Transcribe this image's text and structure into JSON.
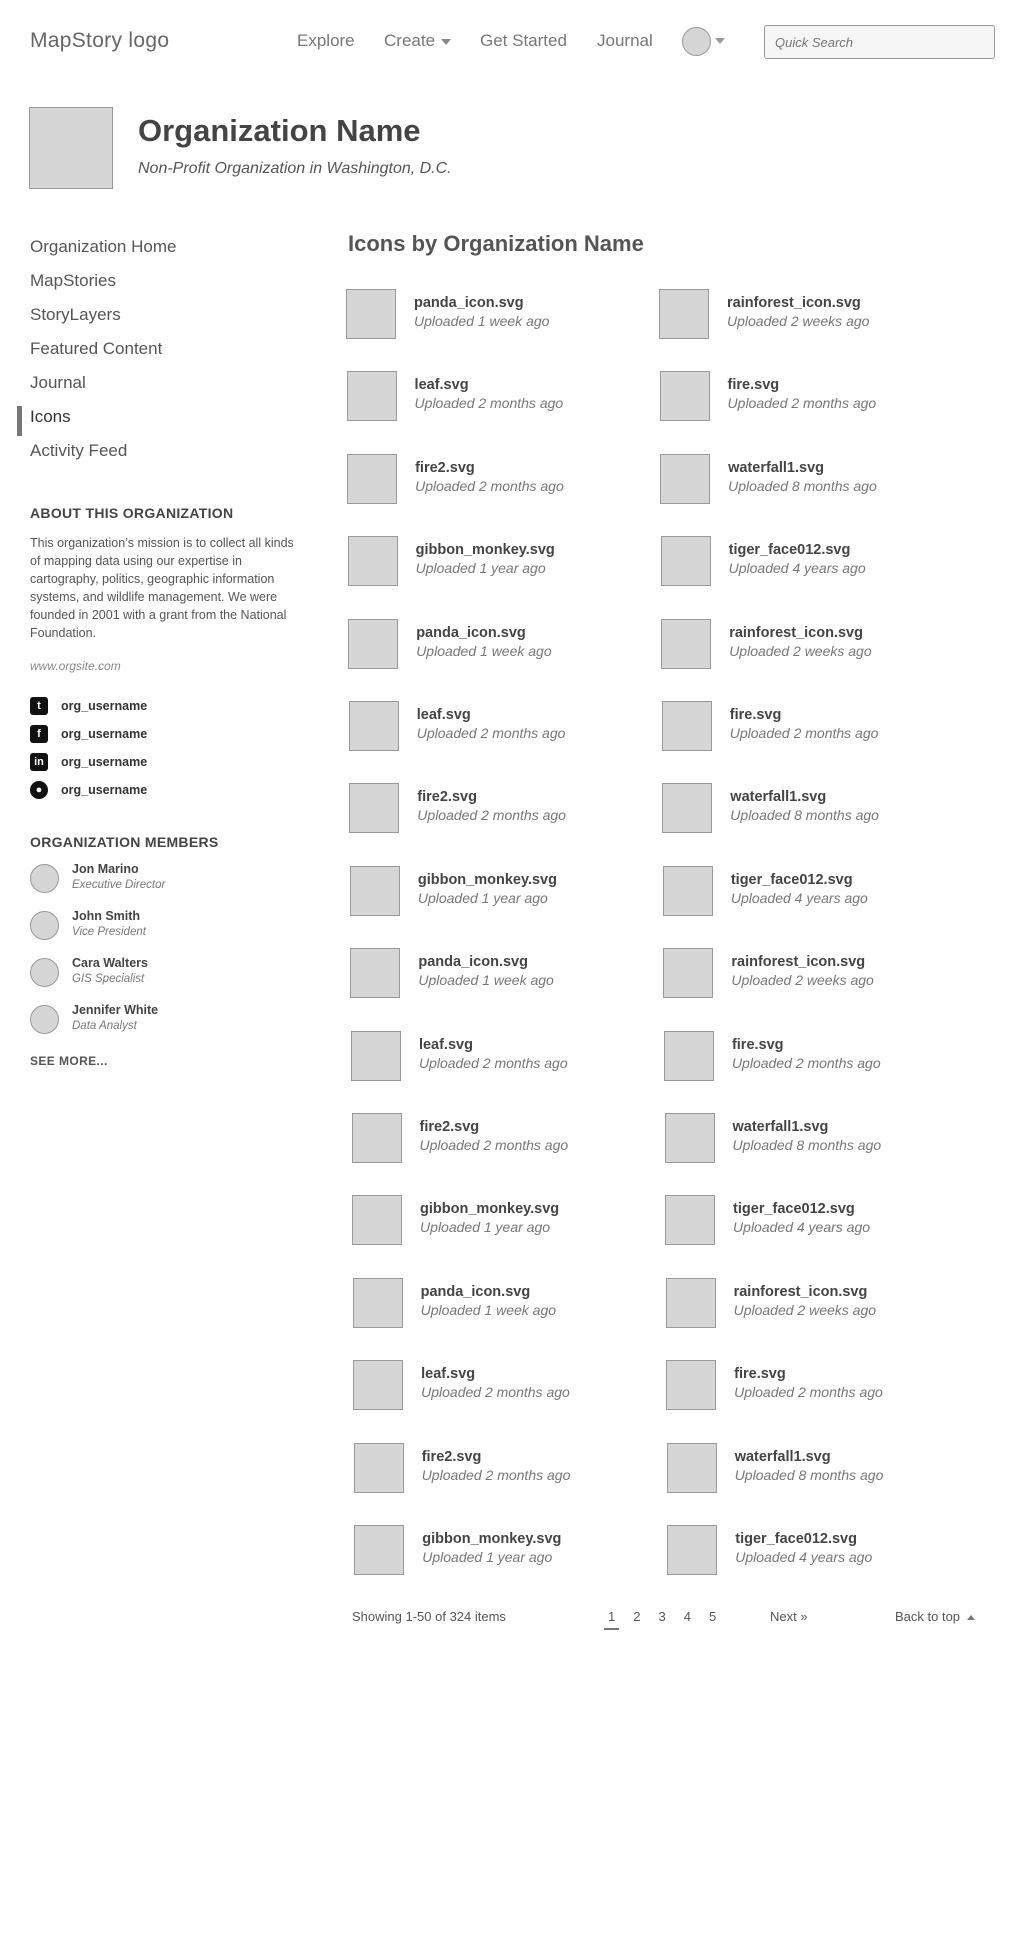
{
  "header": {
    "logo": "MapStory logo",
    "nav": [
      "Explore",
      "Create",
      "Get Started",
      "Journal"
    ],
    "search_placeholder": "Quick Search"
  },
  "org": {
    "name": "Organization Name",
    "subtitle": "Non-Profit Organization in Washington, D.C."
  },
  "sidebar": {
    "items": [
      "Organization Home",
      "MapStories",
      "StoryLayers",
      "Featured Content",
      "Journal",
      "Icons",
      "Activity Feed"
    ],
    "active_index": 5,
    "about_title": "ABOUT THIS ORGANIZATION",
    "about_text": "This organization’s mission is to collect all kinds of mapping data using our expertise in cartography, politics, geographic information systems, and wildlife management. We were founded in 2001 with a grant from the National Foundation.",
    "website": "www.orgsite.com",
    "social": [
      {
        "icon": "twitter-icon",
        "label": "org_username"
      },
      {
        "icon": "facebook-icon",
        "label": "org_username"
      },
      {
        "icon": "linkedin-icon",
        "label": "org_username"
      },
      {
        "icon": "github-icon",
        "label": "org_username"
      }
    ],
    "members_title": "ORGANIZATION MEMBERS",
    "members": [
      {
        "name": "Jon Marino",
        "role": "Executive Director"
      },
      {
        "name": "John Smith",
        "role": "Vice President"
      },
      {
        "name": "Cara Walters",
        "role": "GIS Specialist"
      },
      {
        "name": "Jennifer White",
        "role": "Data Analyst"
      }
    ],
    "see_more": "SEE MORE..."
  },
  "main": {
    "title": "Icons by Organization Name",
    "icons": [
      {
        "name": "panda_icon.svg",
        "date": "Uploaded 1 week ago"
      },
      {
        "name": "rainforest_icon.svg",
        "date": "Uploaded 2 weeks ago"
      },
      {
        "name": "leaf.svg",
        "date": "Uploaded 2 months ago"
      },
      {
        "name": "fire.svg",
        "date": "Uploaded 2 months ago"
      },
      {
        "name": "fire2.svg",
        "date": "Uploaded 2 months ago"
      },
      {
        "name": "waterfall1.svg",
        "date": "Uploaded 8 months ago"
      },
      {
        "name": "gibbon_monkey.svg",
        "date": "Uploaded 1 year ago"
      },
      {
        "name": "tiger_face012.svg",
        "date": "Uploaded 4 years ago"
      },
      {
        "name": "panda_icon.svg",
        "date": "Uploaded 1 week ago"
      },
      {
        "name": "rainforest_icon.svg",
        "date": "Uploaded 2 weeks ago"
      },
      {
        "name": "leaf.svg",
        "date": "Uploaded 2 months ago"
      },
      {
        "name": "fire.svg",
        "date": "Uploaded 2 months ago"
      },
      {
        "name": "fire2.svg",
        "date": "Uploaded 2 months ago"
      },
      {
        "name": "waterfall1.svg",
        "date": "Uploaded 8 months ago"
      },
      {
        "name": "gibbon_monkey.svg",
        "date": "Uploaded 1 year ago"
      },
      {
        "name": "tiger_face012.svg",
        "date": "Uploaded 4 years ago"
      },
      {
        "name": "panda_icon.svg",
        "date": "Uploaded 1 week ago"
      },
      {
        "name": "rainforest_icon.svg",
        "date": "Uploaded 2 weeks ago"
      },
      {
        "name": "leaf.svg",
        "date": "Uploaded 2 months ago"
      },
      {
        "name": "fire.svg",
        "date": "Uploaded 2 months ago"
      },
      {
        "name": "fire2.svg",
        "date": "Uploaded 2 months ago"
      },
      {
        "name": "waterfall1.svg",
        "date": "Uploaded 8 months ago"
      },
      {
        "name": "gibbon_monkey.svg",
        "date": "Uploaded 1 year ago"
      },
      {
        "name": "tiger_face012.svg",
        "date": "Uploaded 4 years ago"
      },
      {
        "name": "panda_icon.svg",
        "date": "Uploaded 1 week ago"
      },
      {
        "name": "rainforest_icon.svg",
        "date": "Uploaded 2 weeks ago"
      },
      {
        "name": "leaf.svg",
        "date": "Uploaded 2 months ago"
      },
      {
        "name": "fire.svg",
        "date": "Uploaded 2 months ago"
      },
      {
        "name": "fire2.svg",
        "date": "Uploaded 2 months ago"
      },
      {
        "name": "waterfall1.svg",
        "date": "Uploaded 8 months ago"
      },
      {
        "name": "gibbon_monkey.svg",
        "date": "Uploaded 1 year ago"
      },
      {
        "name": "tiger_face012.svg",
        "date": "Uploaded 4 years ago"
      }
    ]
  },
  "footer": {
    "showing": "Showing 1-50 of 324 items",
    "pages": [
      "1",
      "2",
      "3",
      "4",
      "5"
    ],
    "current_page": "1",
    "next": "Next »",
    "back_to_top": "Back to top"
  }
}
